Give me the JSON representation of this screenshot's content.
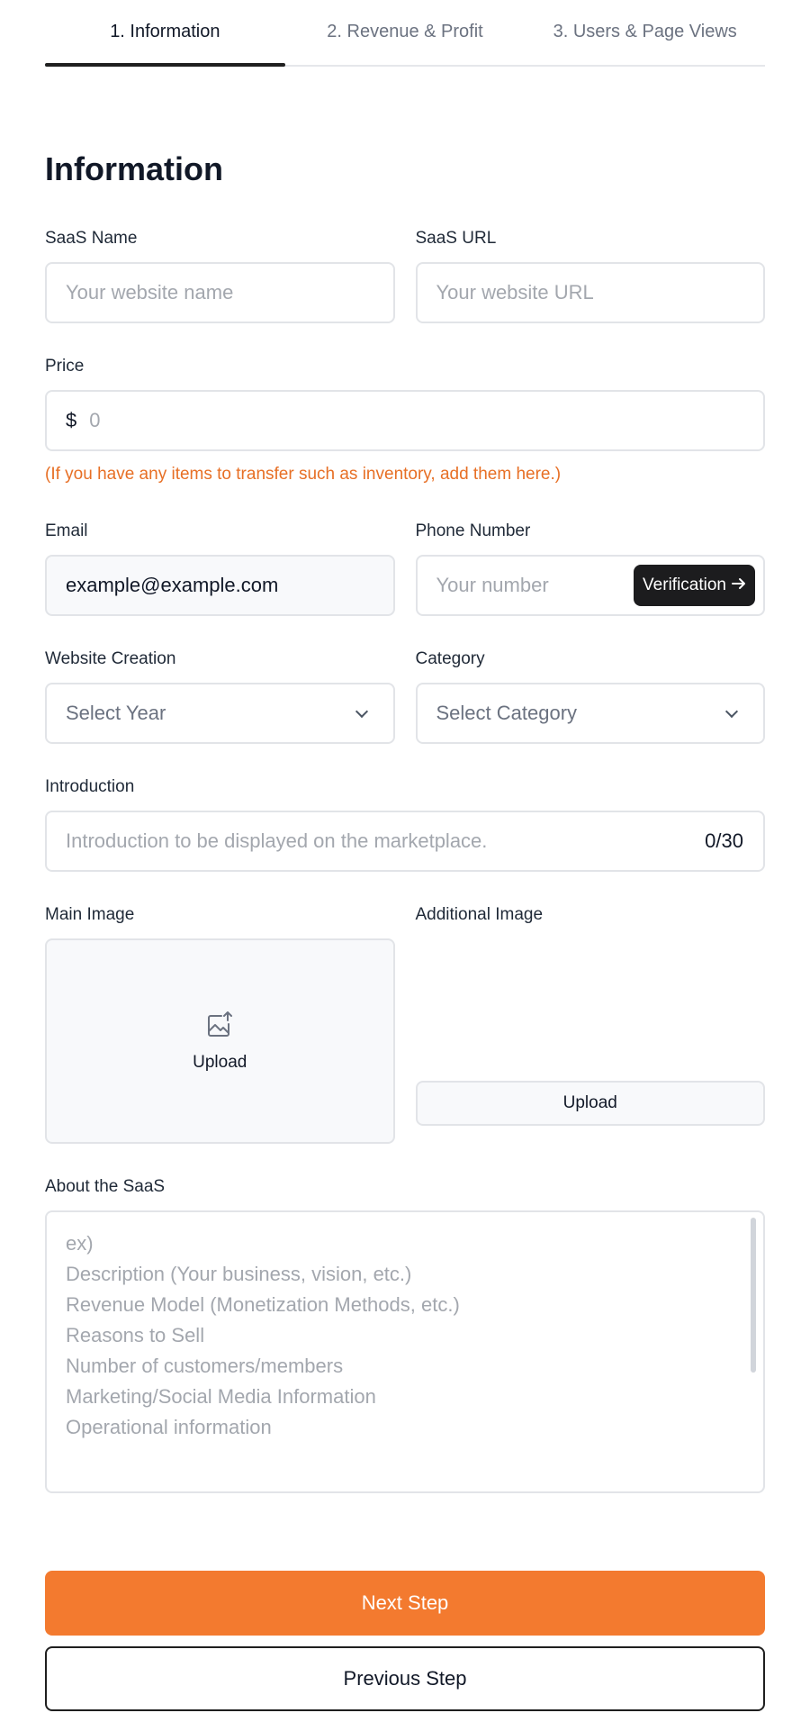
{
  "tabs": [
    {
      "label": "1. Information",
      "active": true
    },
    {
      "label": "2. Revenue & Profit",
      "active": false
    },
    {
      "label": "3. Users & Page Views",
      "active": false
    }
  ],
  "section_title": "Information",
  "fields": {
    "saas_name": {
      "label": "SaaS Name",
      "placeholder": "Your website name"
    },
    "saas_url": {
      "label": "SaaS URL",
      "placeholder": "Your website URL"
    },
    "price": {
      "label": "Price",
      "currency": "$",
      "placeholder": "0",
      "hint": "(If you have any items to transfer such as inventory, add them here.)"
    },
    "email": {
      "label": "Email",
      "value": "example@example.com"
    },
    "phone": {
      "label": "Phone Number",
      "placeholder": "Your number",
      "verify_label": "Verification",
      "verify_icon": "arrow-right-icon"
    },
    "website_creation": {
      "label": "Website Creation",
      "selected": "Select Year"
    },
    "category": {
      "label": "Category",
      "selected": "Select Category"
    },
    "introduction": {
      "label": "Introduction",
      "placeholder": "Introduction to be displayed on the marketplace.",
      "counter": "0/30"
    },
    "main_image": {
      "label": "Main Image",
      "upload_label": "Upload",
      "icon": "image-upload-icon"
    },
    "additional_image": {
      "label": "Additional Image",
      "upload_label": "Upload"
    },
    "about": {
      "label": "About the SaaS",
      "placeholder_lines": [
        "ex)",
        "Description (Your business, vision, etc.)",
        "Revenue Model (Monetization Methods, etc.)",
        "Reasons to Sell",
        "Number of customers/members",
        "Marketing/Social Media Information",
        "Operational information"
      ]
    }
  },
  "buttons": {
    "next": "Next Step",
    "previous": "Previous Step"
  },
  "colors": {
    "accent": "#f37a2f",
    "hint": "#e76f25",
    "dark": "#1c1c1e"
  }
}
